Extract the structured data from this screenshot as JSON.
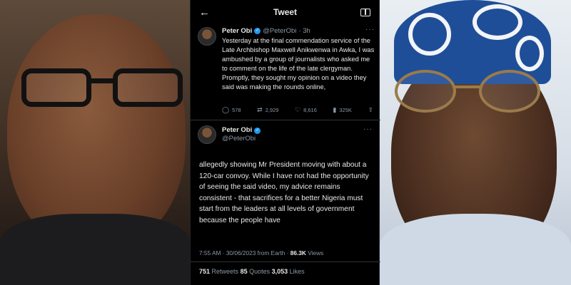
{
  "header": {
    "back_icon": "arrow-left-icon",
    "title": "Tweet",
    "reader_icon": "reader-view-icon"
  },
  "tweet1": {
    "name": "Peter Obi",
    "handle": "@PeterObi",
    "time": "· 3h",
    "text": "Yesterday at the final commendation service of the Late Archbishop Maxwell Anikwenwa in Awka, I was ambushed by a group of journalists who asked me to comment on the life of the late clergyman. Promptly, they sought my opinion on a video they said was making the rounds online,",
    "actions": [
      {
        "icon": "reply-icon",
        "glyph": "◯",
        "count": "578"
      },
      {
        "icon": "retweet-icon",
        "glyph": "⇄",
        "count": "2,929"
      },
      {
        "icon": "like-icon",
        "glyph": "♡",
        "count": "8,616"
      },
      {
        "icon": "views-icon",
        "glyph": "▮",
        "count": "325K"
      },
      {
        "icon": "share-icon",
        "glyph": "⇪",
        "count": ""
      }
    ]
  },
  "tweet2": {
    "name": "Peter Obi",
    "handle": "@PeterObi",
    "text": "allegedly showing Mr President moving with about a 120-car convoy. While I have not had the opportunity of seeing the said video, my advice remains consistent - that sacrifices for a better Nigeria must start from the leaders at all levels of government because the people have",
    "timestamp": "7:55 AM · 30/06/2023 from Earth · ",
    "views_count": "86.3K",
    "views_label": " Views",
    "retweets": "751",
    "retweets_label": " Retweets  ",
    "quotes": "85",
    "quotes_label": " Quotes  ",
    "likes": "3,053",
    "likes_label": " Likes"
  },
  "colors": {
    "verified": "#1d9bf0",
    "text": "#e7e9ea",
    "muted": "#8b98a5",
    "background": "#000000"
  }
}
